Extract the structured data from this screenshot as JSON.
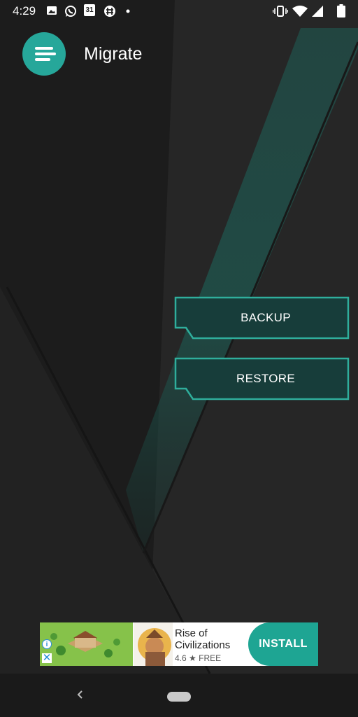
{
  "status_bar": {
    "time": "4:29",
    "calendar_day": "31",
    "notification_icons": [
      "image-icon",
      "whatsapp-icon",
      "calendar-icon",
      "slack-icon",
      "dot-icon"
    ],
    "system_icons": [
      "vibrate-icon",
      "wifi-icon",
      "signal-icon",
      "battery-icon"
    ]
  },
  "app_bar": {
    "title": "Migrate",
    "menu_icon": "menu-icon"
  },
  "actions": {
    "backup_label": "BACKUP",
    "restore_label": "RESTORE"
  },
  "ad": {
    "title": "Rise of Civilizations",
    "rating": "4.6",
    "price": "FREE",
    "install_label": "INSTALL"
  },
  "colors": {
    "accent": "#26a79a",
    "button_fill": "#173d3a",
    "button_border": "#2fae9c",
    "background": "#1c1c1c"
  }
}
